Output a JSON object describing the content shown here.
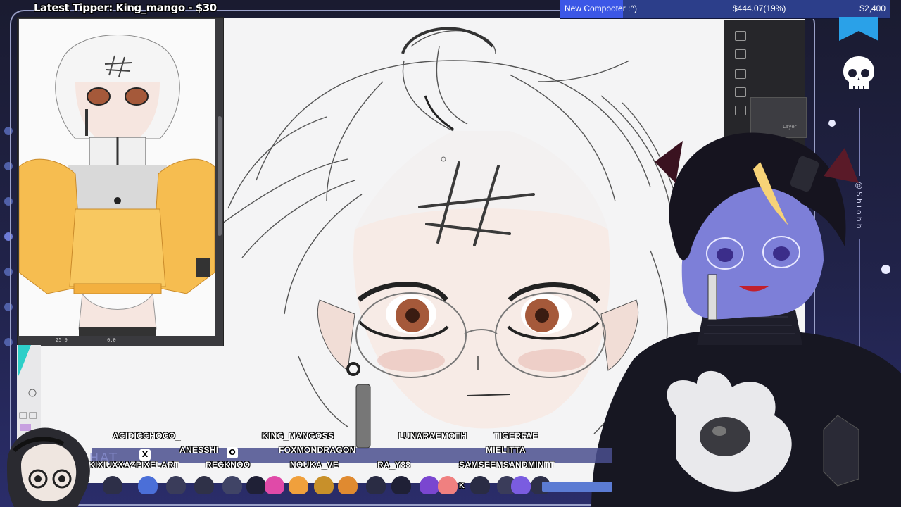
{
  "stream": {
    "latest_tipper": "Latest Tipper: King_mango - $30",
    "goal": {
      "name": "New Compooter :^)",
      "current": "$444.07(19%)",
      "target": "$2,400",
      "progress": 0.19,
      "fill_color": "#3c57e6"
    },
    "handle": "@Shiohh",
    "chat_label": "CHAT"
  },
  "art_app": {
    "reference_status": {
      "zoom": "25.9",
      "angle": "0.0"
    },
    "layer_label": "Layer"
  },
  "chatters": [
    "ACIDICCHOCO_",
    "KING_MANGOSS",
    "LUNARAEMOTH",
    "TIGERFAE",
    "ANESSHI",
    "FOXMONDRAGON",
    "MIELITTA",
    "KIXIUXXAZPIXELART",
    "RECKNOO",
    "NOUKA_VE",
    "RA_Y88",
    "SAMSEEMSANDMINTT"
  ],
  "key_hints": [
    "X",
    "O",
    "K"
  ],
  "colors": {
    "accent": "#3c57e6",
    "jacket": "#f6bd50",
    "background": "#1c1d33"
  }
}
